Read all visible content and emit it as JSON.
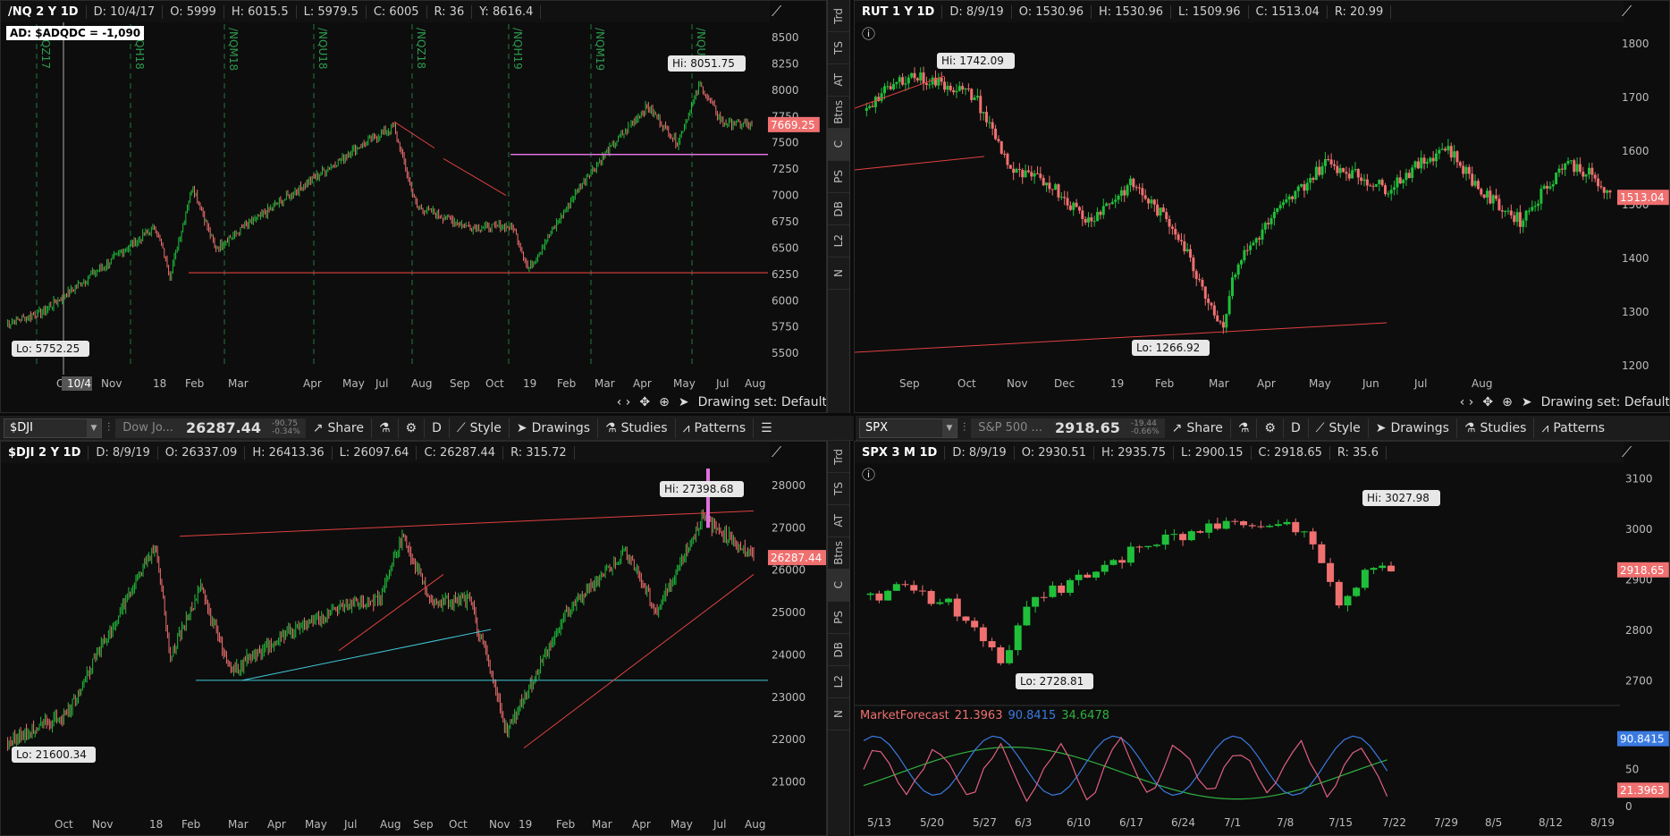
{
  "colors": {
    "up": "#1fbf3a",
    "down": "#f07070",
    "bg": "#0d0d0d",
    "magenta": "#e070e0",
    "cyan": "#40c8d8",
    "trend": "#e04040",
    "ind_pink": "#e06080",
    "ind_blue": "#3a7ae0",
    "ind_green": "#30b040"
  },
  "nq": {
    "header": {
      "symbol": "/NQ 2 Y 1D",
      "date": "D: 10/4/17",
      "open": "O: 5999",
      "high": "H: 6015.5",
      "low": "L: 5979.5",
      "close": "C: 6005",
      "range": "R: 36",
      "y": "Y: 8616.4"
    },
    "ad_label": "AD: $ADQDC = -1,090",
    "markers": [
      "/NQZ17",
      "/NQH18",
      "/NQM18",
      "/NQU18",
      "/NQZ18",
      "/NQH19",
      "/NQM19",
      "/NQU"
    ],
    "hi_label": "Hi: 8051.75",
    "lo_label": "Lo: 5752.25",
    "price_tag": "7669.25",
    "y_ticks": [
      "8500",
      "8250",
      "8000",
      "7750",
      "7500",
      "7250",
      "7000",
      "6750",
      "6500",
      "6250",
      "6000",
      "5750",
      "5500"
    ],
    "x_ticks": [
      "Oct",
      "Nov",
      "18",
      "Feb",
      "Mar",
      "Apr",
      "May",
      "Jul",
      "Aug",
      "Sep",
      "Oct",
      "19",
      "Feb",
      "Mar",
      "Apr",
      "May",
      "Jul",
      "Aug"
    ],
    "cursor_label": "10/4",
    "drawing_set": "Drawing set: Default"
  },
  "rut": {
    "header": {
      "symbol": "RUT 1 Y 1D",
      "date": "D: 8/9/19",
      "open": "O: 1530.96",
      "high": "H: 1530.96",
      "low": "L: 1509.96",
      "close": "C: 1513.04",
      "range": "R: 20.99"
    },
    "hi_label": "Hi: 1742.09",
    "lo_label": "Lo: 1266.92",
    "price_tag": "1513.04",
    "y_ticks": [
      "1800",
      "1700",
      "1600",
      "1500",
      "1400",
      "1300",
      "1200"
    ],
    "x_ticks": [
      "Sep",
      "Oct",
      "Nov",
      "Dec",
      "19",
      "Feb",
      "Mar",
      "Apr",
      "May",
      "Jun",
      "Jul",
      "Aug"
    ],
    "drawing_set": "Drawing set: Default"
  },
  "left_toolbar": {
    "symbol": "$DJI",
    "desc": "Dow Jo...",
    "last": "26287.44",
    "chg1": "-90.75",
    "chg2": "-0.34%",
    "share": "Share",
    "period": "D",
    "style": "Style",
    "drawings": "Drawings",
    "studies": "Studies",
    "patterns": "Patterns"
  },
  "right_toolbar": {
    "symbol": "SPX",
    "desc": "S&P 500 ...",
    "last": "2918.65",
    "chg1": "-19.44",
    "chg2": "-0.66%",
    "share": "Share",
    "period": "D",
    "style": "Style",
    "drawings": "Drawings",
    "studies": "Studies",
    "patterns": "Patterns"
  },
  "dji": {
    "header": {
      "symbol": "$DJI 2 Y 1D",
      "date": "D: 8/9/19",
      "open": "O: 26337.09",
      "high": "H: 26413.36",
      "low": "L: 26097.64",
      "close": "C: 26287.44",
      "range": "R: 315.72"
    },
    "hi_label": "Hi: 27398.68",
    "lo_label": "Lo: 21600.34",
    "price_tag": "26287.44",
    "y_ticks": [
      "28000",
      "27000",
      "26000",
      "25000",
      "24000",
      "23000",
      "22000",
      "21000"
    ],
    "x_ticks": [
      "Oct",
      "Nov",
      "18",
      "Feb",
      "Mar",
      "Apr",
      "May",
      "Jul",
      "Aug",
      "Sep",
      "Oct",
      "Nov",
      "19",
      "Feb",
      "Mar",
      "Apr",
      "May",
      "Jul",
      "Aug"
    ]
  },
  "spx": {
    "header": {
      "symbol": "SPX 3 M 1D",
      "date": "D: 8/9/19",
      "open": "O: 2930.51",
      "high": "H: 2935.75",
      "low": "L: 2900.15",
      "close": "C: 2918.65",
      "range": "R: 35.6"
    },
    "hi_label": "Hi: 3027.98",
    "lo_label": "Lo: 2728.81",
    "price_tag": "2918.65",
    "y_ticks": [
      "3100",
      "3000",
      "2900",
      "2800",
      "2700"
    ],
    "x_ticks": [
      "5/13",
      "5/20",
      "5/27",
      "6/3",
      "6/10",
      "6/17",
      "6/24",
      "7/1",
      "7/8",
      "7/15",
      "7/22",
      "7/29",
      "8/5",
      "8/12",
      "8/19"
    ],
    "indicator": {
      "name": "MarketForecast",
      "v1": "21.3963",
      "v2": "90.8415",
      "v3": "34.6478",
      "ticks": [
        "50",
        "0"
      ],
      "tag_blue": "90.8415",
      "tag_pink": "21.3963"
    }
  },
  "side_tabs": [
    "Trd",
    "TS",
    "AT",
    "Btns",
    "C",
    "PS",
    "DB",
    "L2",
    "N"
  ]
}
